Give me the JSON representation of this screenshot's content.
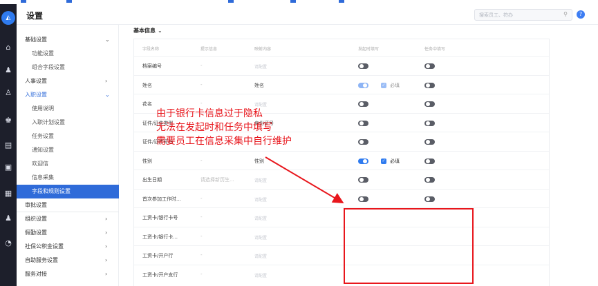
{
  "app": {
    "title": "设置"
  },
  "search": {
    "placeholder": "搜索员工、符办"
  },
  "rail_icons": [
    "logo-icon",
    "home-icon",
    "people-icon",
    "org-icon",
    "user-card-icon",
    "calendar-icon",
    "ticket-icon",
    "report-icon",
    "person-icon",
    "clock-icon"
  ],
  "sidebar": {
    "items": [
      {
        "label": "基础设置",
        "chevron": "⌄",
        "type": "parent"
      },
      {
        "label": "功能设置",
        "type": "sub"
      },
      {
        "label": "组合字段设置",
        "type": "sub"
      },
      {
        "label": "人事设置",
        "chevron": "›",
        "type": "parent"
      },
      {
        "label": "入职设置",
        "chevron": "⌄",
        "type": "active-parent"
      },
      {
        "label": "使用说明",
        "type": "sub"
      },
      {
        "label": "入职计划设置",
        "type": "sub"
      },
      {
        "label": "任务设置",
        "type": "sub"
      },
      {
        "label": "通知设置",
        "type": "sub"
      },
      {
        "label": "欢迎信",
        "type": "sub"
      },
      {
        "label": "信息采集",
        "type": "sub"
      },
      {
        "label": "字段和规则设置",
        "type": "selected"
      },
      {
        "label": "审批设置",
        "type": "parent"
      },
      {
        "label": "组织设置",
        "chevron": "›",
        "type": "parent"
      },
      {
        "label": "假勤设置",
        "chevron": "›",
        "type": "parent"
      },
      {
        "label": "社保公积金设置",
        "chevron": "›",
        "type": "parent"
      },
      {
        "label": "自助服务设置",
        "chevron": "›",
        "type": "parent"
      },
      {
        "label": "服务对接",
        "chevron": "›",
        "type": "parent"
      }
    ]
  },
  "section": {
    "title": "基本信息",
    "chevron": "⌄"
  },
  "table": {
    "headers": [
      "字段名称",
      "提示信息",
      "映射内容",
      "发起时填写",
      "任务中填写"
    ],
    "rows": [
      {
        "name": "档案编号",
        "hint": "-",
        "map": "请配置",
        "map_muted": true,
        "start": "off",
        "start_req": "",
        "task": "off"
      },
      {
        "name": "姓名",
        "hint": "-",
        "map": "姓名",
        "map_muted": false,
        "start": "on-light",
        "start_req": "必填",
        "start_req_light": true,
        "task": "off"
      },
      {
        "name": "花名",
        "hint": "-",
        "map": "请配置",
        "map_muted": true,
        "start": "off",
        "start_req": "",
        "task": "off"
      },
      {
        "name": "证件/证件类型",
        "hint": "-",
        "map": "身份证号",
        "map_muted": false,
        "start": "off",
        "start_req": "",
        "task": "off"
      },
      {
        "name": "证件/证件号码",
        "hint": "-",
        "map": "-",
        "map_muted": false,
        "start": "off",
        "start_req": "",
        "task": "off"
      },
      {
        "name": "性别",
        "hint": "-",
        "map": "性别",
        "map_muted": false,
        "start": "on",
        "start_req": "必填",
        "start_req_light": false,
        "task": "off"
      },
      {
        "name": "出生日期",
        "hint": "请选择新历生...",
        "map": "请配置",
        "map_muted": true,
        "start": "off",
        "start_req": "",
        "task": "off"
      },
      {
        "name": "首次参加工作时...",
        "hint": "-",
        "map": "请配置",
        "map_muted": true,
        "start": "off",
        "start_req": "",
        "task": "off"
      },
      {
        "name": "工资卡/银行卡号",
        "hint": "-",
        "map": "请配置",
        "map_muted": true,
        "start": "",
        "start_req": "",
        "task": ""
      },
      {
        "name": "工资卡/银行卡...",
        "hint": "-",
        "map": "请配置",
        "map_muted": true,
        "start": "",
        "start_req": "",
        "task": ""
      },
      {
        "name": "工资卡/开户行",
        "hint": "-",
        "map": "请配置",
        "map_muted": true,
        "start": "",
        "start_req": "",
        "task": ""
      },
      {
        "name": "工资卡/开户支行",
        "hint": "-",
        "map": "请配置",
        "map_muted": true,
        "start": "",
        "start_req": "",
        "task": ""
      }
    ]
  },
  "annotation": {
    "lines": [
      "由于银行卡信息过于隐私",
      "无法在发起时和任务中填写",
      "需要员工在信息采集中自行维护"
    ],
    "color": "#e8161c"
  },
  "colors": {
    "accent": "#2f6bd9",
    "rail": "#1d1f2b",
    "annotation": "#e8161c"
  }
}
